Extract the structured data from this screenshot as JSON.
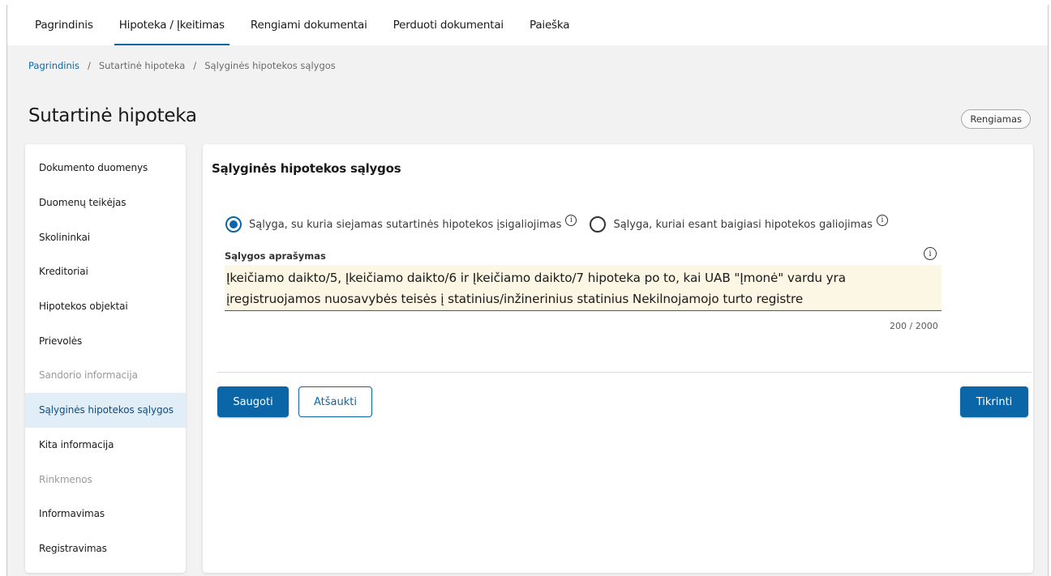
{
  "topnav": {
    "tabs": [
      "Pagrindinis",
      "Hipoteka / Įkeitimas",
      "Rengiami dokumentai",
      "Perduoti dokumentai",
      "Paieška"
    ],
    "active_tab": "Hipoteka / Įkeitimas"
  },
  "breadcrumb": {
    "items": [
      "Pagrindinis",
      "Sutartinė hipoteka",
      "Sąlyginės hipotekos sąlygos"
    ],
    "separator": "/"
  },
  "page": {
    "title": "Sutartinė hipoteka",
    "status": "Rengiamas"
  },
  "sidebar": {
    "items": [
      {
        "label": "Dokumento duomenys",
        "state": "normal"
      },
      {
        "label": "Duomenų teikėjas",
        "state": "normal"
      },
      {
        "label": "Skolininkai",
        "state": "normal"
      },
      {
        "label": "Kreditoriai",
        "state": "normal"
      },
      {
        "label": "Hipotekos objektai",
        "state": "normal"
      },
      {
        "label": "Prievolės",
        "state": "normal"
      },
      {
        "label": "Sandorio informacija",
        "state": "disabled"
      },
      {
        "label": "Sąlyginės hipotekos sąlygos",
        "state": "active"
      },
      {
        "label": "Kita informacija",
        "state": "normal"
      },
      {
        "label": "Rinkmenos",
        "state": "disabled"
      },
      {
        "label": "Informavimas",
        "state": "normal"
      },
      {
        "label": "Registravimas",
        "state": "normal"
      }
    ]
  },
  "main": {
    "section_title": "Sąlyginės hipotekos sąlygos",
    "radio_options": [
      {
        "label": "Sąlyga, su kuria siejamas sutartinės hipotekos įsigaliojimas",
        "checked": true,
        "icon": "info-icon"
      },
      {
        "label": "Sąlyga, kuriai esant baigiasi hipotekos galiojimas",
        "checked": false,
        "icon": "info-icon"
      }
    ],
    "field_label": "Sąlygos aprašymas",
    "field_value": "Įkeičiamo daikto/5, Įkeičiamo daikto/6 ir Įkeičiamo daikto/7 hipoteka po to, kai UAB \"Įmonė\" vardu yra įregistruojamos nuosavybės teisės į statinius/inžinerinius statinius Nekilnojamojo turto registre",
    "char_counter": "200 / 2000",
    "buttons": {
      "save": "Saugoti",
      "cancel": "Atšaukti",
      "check": "Tikrinti"
    }
  },
  "colors": {
    "primary": "#0b66a8",
    "active_sidebar_bg": "#e1edf7",
    "textarea_bg": "#fcf6e4",
    "page_bg": "#f2f2f2",
    "brand_mark": "#1fb57a"
  }
}
